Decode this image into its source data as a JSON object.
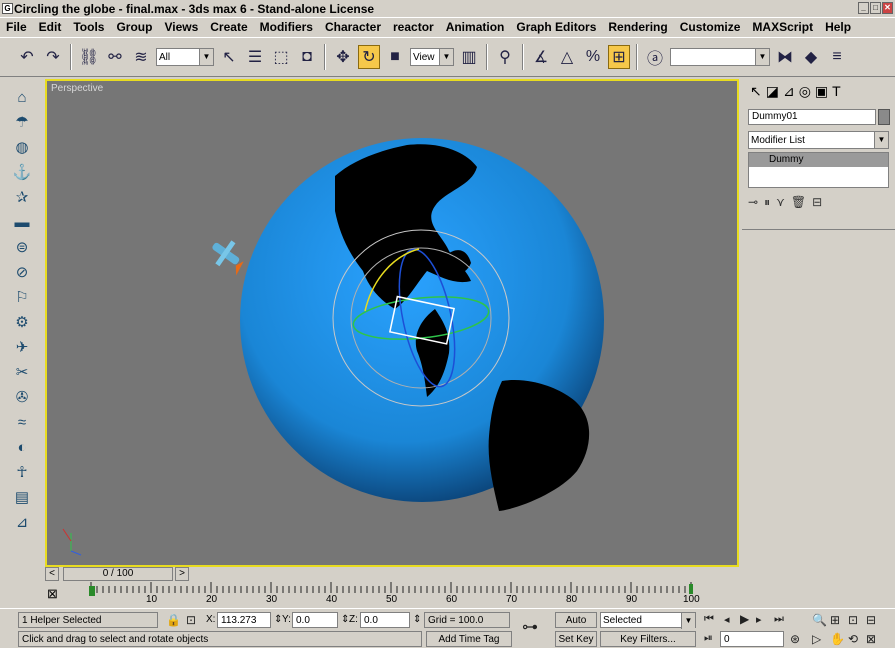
{
  "window": {
    "title": "Circling the globe - final.max - 3ds max 6 - Stand-alone License",
    "app_icon": "3ds-max-icon"
  },
  "menu": [
    "File",
    "Edit",
    "Tools",
    "Group",
    "Views",
    "Create",
    "Modifiers",
    "Character",
    "reactor",
    "Animation",
    "Graph Editors",
    "Rendering",
    "Customize",
    "MAXScript",
    "Help"
  ],
  "toolbar": {
    "selection_filter": "All",
    "ref_coord": "View",
    "named_selection": ""
  },
  "viewport": {
    "label": "Perspective",
    "accent_color": "#e8dc20",
    "globe_color": "#1a86d6"
  },
  "command_panel": {
    "object_name": "Dummy01",
    "modifier_list": "Modifier List",
    "stack_item": "Dummy"
  },
  "time": {
    "slider_label": "0 / 100",
    "ticks": [
      "10",
      "20",
      "30",
      "40",
      "50",
      "60",
      "70",
      "80",
      "90",
      "100"
    ]
  },
  "status": {
    "selection": "1 Helper Selected",
    "prompt": "Click and drag to select and rotate objects",
    "x_label": "X:",
    "x_value": "113.273",
    "y_label": "Y:",
    "y_value": "0.0",
    "z_label": "Z:",
    "z_value": "0.0",
    "grid": "Grid = 100.0",
    "add_time_tag": "Add Time Tag",
    "auto_key": "Auto Key",
    "set_key": "Set Key",
    "key_mode": "Selected",
    "key_filters": "Key Filters...",
    "frame": "0"
  }
}
